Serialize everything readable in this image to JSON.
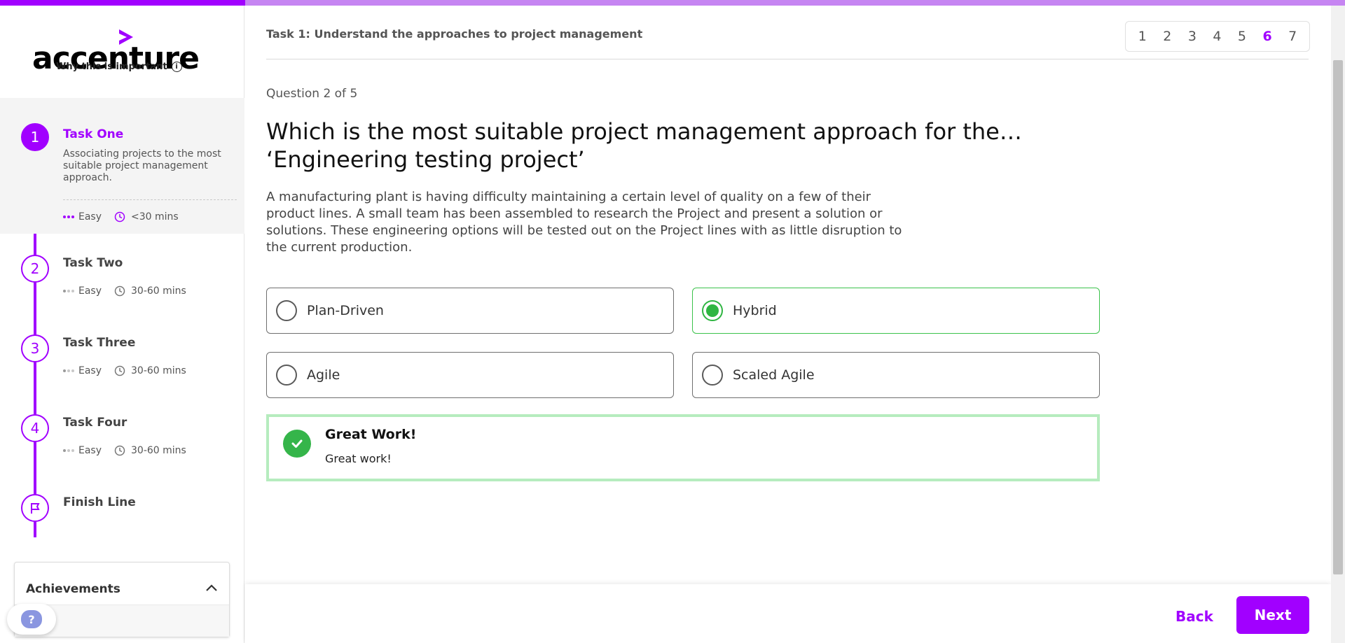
{
  "brand": {
    "name": "accenture",
    "accent": "#a100ff",
    "success": "#35b54a"
  },
  "sidebar": {
    "tasks": [
      {
        "number": "1",
        "title": "Task One",
        "description": "Associating projects to the most suitable project management approach.",
        "difficulty": "Easy",
        "duration": "<30 mins",
        "active": true
      },
      {
        "number": "2",
        "title": "Task Two",
        "difficulty": "Easy",
        "duration": "30-60 mins"
      },
      {
        "number": "3",
        "title": "Task Three",
        "difficulty": "Easy",
        "duration": "30-60 mins"
      },
      {
        "number": "4",
        "title": "Task Four",
        "difficulty": "Easy",
        "duration": "30-60 mins"
      }
    ],
    "finish": {
      "title": "Finish Line",
      "icon": "flag-icon"
    },
    "achievements": {
      "title": "Achievements",
      "why_label": "Why this is important"
    }
  },
  "header": {
    "task_title": "Task 1: Understand the approaches to project management",
    "pages": [
      "1",
      "2",
      "3",
      "4",
      "5",
      "6",
      "7"
    ],
    "current_page": "6"
  },
  "question": {
    "counter": "Question 2 of 5",
    "title": "Which is the most suitable project management approach for the… ‘Engineering testing project’",
    "body": "A manufacturing plant is having difficulty maintaining a certain level of quality on a few of their product lines. A small team has been assembled to research the Project and present a solution or solutions. These engineering options will be tested out on the Project lines with as little disruption to the current production.",
    "options": [
      {
        "label": "Plan-Driven",
        "selected": false
      },
      {
        "label": "Hybrid",
        "selected": true
      },
      {
        "label": "Agile",
        "selected": false
      },
      {
        "label": "Scaled Agile",
        "selected": false
      }
    ]
  },
  "feedback": {
    "title": "Great Work!",
    "text": "Great work!"
  },
  "footer": {
    "back_label": "Back",
    "next_label": "Next"
  }
}
